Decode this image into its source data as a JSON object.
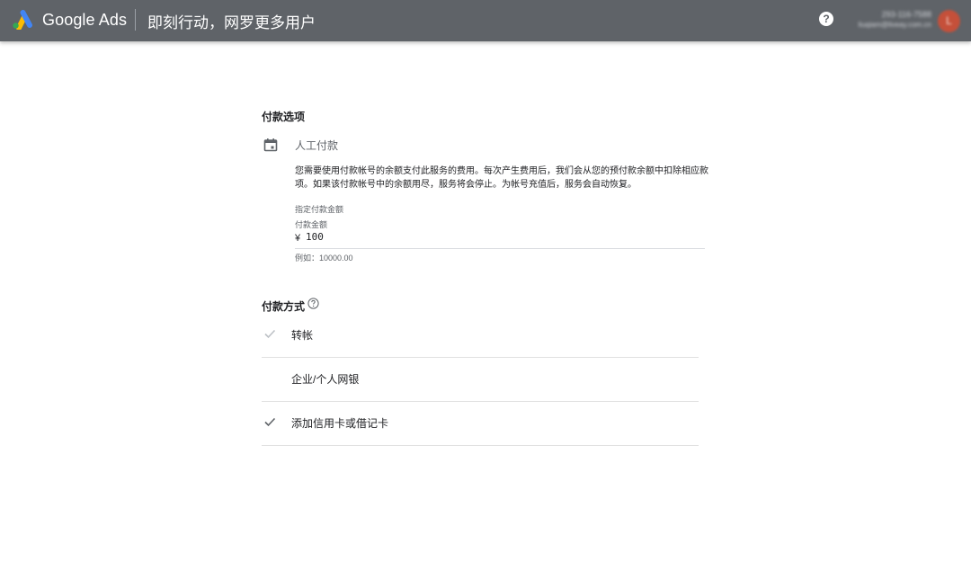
{
  "header": {
    "brand": "Google Ads",
    "tagline": "即刻行动，网罗更多用户",
    "help_icon": "help-circle-icon",
    "account": {
      "id": "293-116-7588",
      "email": "liuqiam@liveay.com.cn",
      "avatar_initial": "L"
    },
    "colors": {
      "bar": "#5f6368",
      "avatar": "#c5503a"
    }
  },
  "payment_options": {
    "title": "付款选项",
    "icon": "calendar-icon",
    "option_label": "人工付款",
    "description": "您需要使用付款帐号的余额支付此服务的费用。每次产生费用后，我们会从您的预付款余额中扣除相应款项。如果该付款帐号中的余额用尽，服务将会停止。为帐号充值后，服务会自动恢复。",
    "amount_section_label": "指定付款金额",
    "amount_field_label": "付款金额",
    "currency_symbol": "¥",
    "amount_value": "100",
    "amount_hint": "例如：10000.00"
  },
  "payment_methods": {
    "title": "付款方式",
    "help_icon": "help-circle-outline-icon",
    "items": [
      {
        "label": "转帐",
        "check_icon": "check-icon",
        "checked": true,
        "check_color": "#bdc1c6"
      },
      {
        "label": "企业/个人网银",
        "check_icon": "",
        "checked": false,
        "check_color": ""
      },
      {
        "label": "添加信用卡或借记卡",
        "check_icon": "check-icon",
        "checked": true,
        "check_color": "#5f6368"
      }
    ]
  }
}
